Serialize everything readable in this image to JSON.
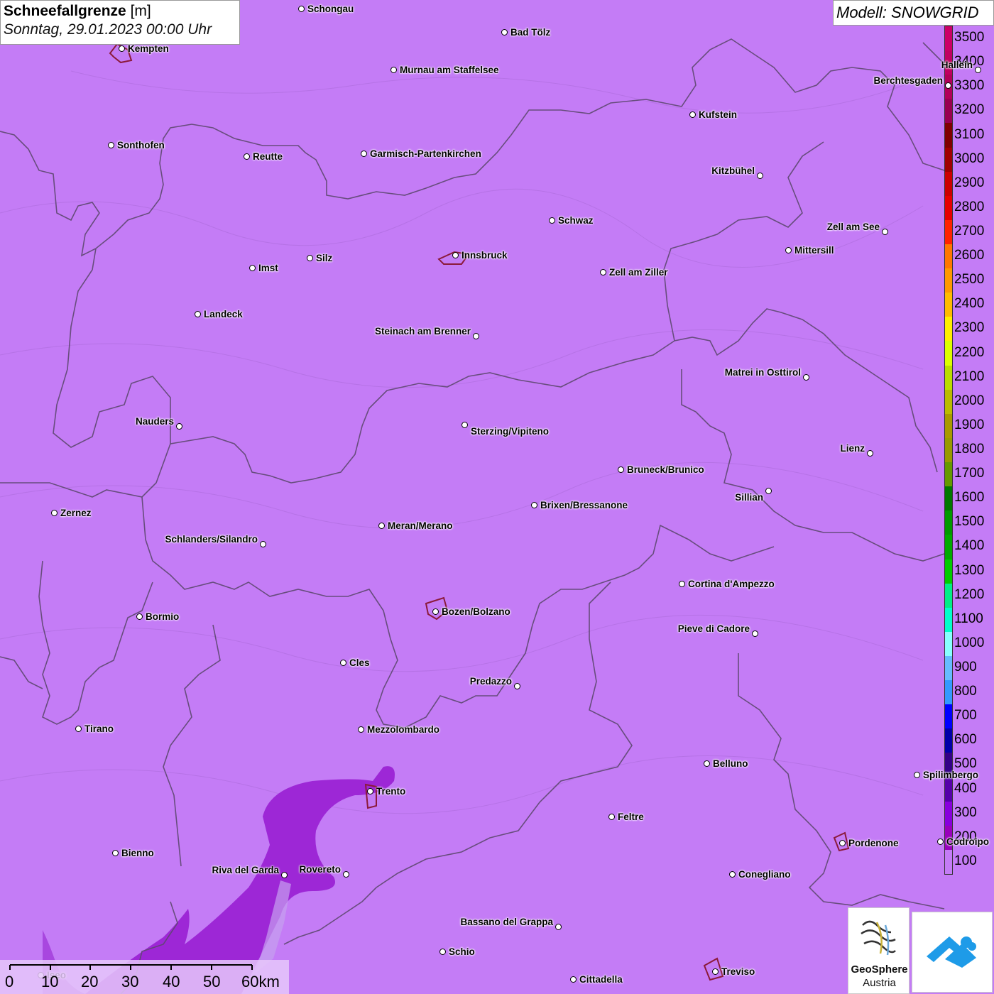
{
  "title": {
    "variable": "Schneefallgrenze",
    "unit": "[m]",
    "datetime": "Sonntag, 29.01.2023 00:00 Uhr"
  },
  "model": {
    "label": "Modell: SNOWGRID"
  },
  "legend": {
    "labels": [
      "3500",
      "3400",
      "3300",
      "3200",
      "3100",
      "3000",
      "2900",
      "2800",
      "2700",
      "2600",
      "2500",
      "2400",
      "2300",
      "2200",
      "2100",
      "2000",
      "1900",
      "1800",
      "1700",
      "1600",
      "1500",
      "1400",
      "1300",
      "1200",
      "1100",
      "1000",
      "900",
      "800",
      "700",
      "600",
      "500",
      "400",
      "300",
      "200",
      "100"
    ],
    "colors": [
      "#cc0066",
      "#c00060",
      "#b20058",
      "#990050",
      "#800000",
      "#a00000",
      "#cc0000",
      "#e60000",
      "#ff2200",
      "#ff7700",
      "#ff9900",
      "#ffbb00",
      "#ffee00",
      "#ddff00",
      "#bbdd00",
      "#bbbb00",
      "#aa9900",
      "#999900",
      "#669900",
      "#007700",
      "#009900",
      "#00aa00",
      "#00cc00",
      "#00ee88",
      "#00ffcc",
      "#88ffff",
      "#66bbff",
      "#3399ff",
      "#0000ff",
      "#0000aa",
      "#330088",
      "#5500aa",
      "#8800dd",
      "#9900bb",
      "#c47cf6"
    ]
  },
  "map_colors": {
    "background": "#c47cf6",
    "precip_300": "#9a22d4",
    "precip_200": "#a847df",
    "border_line": "#6a4a7a",
    "city_outline": "#8b1a3a"
  },
  "cities": [
    {
      "name": "Schongau"
    },
    {
      "name": "Kempten"
    },
    {
      "name": "Bad Tölz"
    },
    {
      "name": "Murnau am Staffelsee"
    },
    {
      "name": "Hallein"
    },
    {
      "name": "Berchtesgaden"
    },
    {
      "name": "Kufstein"
    },
    {
      "name": "Sonthofen"
    },
    {
      "name": "Reutte"
    },
    {
      "name": "Garmisch-Partenkirchen"
    },
    {
      "name": "Kitzbühel"
    },
    {
      "name": "Schwaz"
    },
    {
      "name": "Zell am See"
    },
    {
      "name": "Innsbruck"
    },
    {
      "name": "Mittersill"
    },
    {
      "name": "Silz"
    },
    {
      "name": "Imst"
    },
    {
      "name": "Zell am Ziller"
    },
    {
      "name": "Landeck"
    },
    {
      "name": "Steinach am Brenner"
    },
    {
      "name": "Matrei in Osttirol"
    },
    {
      "name": "Nauders"
    },
    {
      "name": "Sterzing/Vipiteno"
    },
    {
      "name": "Lienz"
    },
    {
      "name": "Bruneck/Brunico"
    },
    {
      "name": "Sillian"
    },
    {
      "name": "Zernez"
    },
    {
      "name": "Brixen/Bressanone"
    },
    {
      "name": "Meran/Merano"
    },
    {
      "name": "Schlanders/Silandro"
    },
    {
      "name": "Cortina d'Ampezzo"
    },
    {
      "name": "Bozen/Bolzano"
    },
    {
      "name": "Bormio"
    },
    {
      "name": "Pieve di Cadore"
    },
    {
      "name": "Cles"
    },
    {
      "name": "Predazzo"
    },
    {
      "name": "Tirano"
    },
    {
      "name": "Mezzolombardo"
    },
    {
      "name": "Belluno"
    },
    {
      "name": "Spilimbergo"
    },
    {
      "name": "Trento"
    },
    {
      "name": "Feltre"
    },
    {
      "name": "Pordenone"
    },
    {
      "name": "Codroipo"
    },
    {
      "name": "Bienno"
    },
    {
      "name": "Riva del Garda"
    },
    {
      "name": "Rovereto"
    },
    {
      "name": "Conegliano"
    },
    {
      "name": "Bassano del Grappa"
    },
    {
      "name": "Schio"
    },
    {
      "name": "Treviso"
    },
    {
      "name": "Cittadella"
    },
    {
      "name": "Iseo"
    }
  ],
  "scale": {
    "labels": [
      "0",
      "10",
      "20",
      "30",
      "40",
      "50",
      "60km"
    ]
  },
  "logos": {
    "geosphere_line1": "GeoSphere",
    "geosphere_line2": "Austria"
  }
}
